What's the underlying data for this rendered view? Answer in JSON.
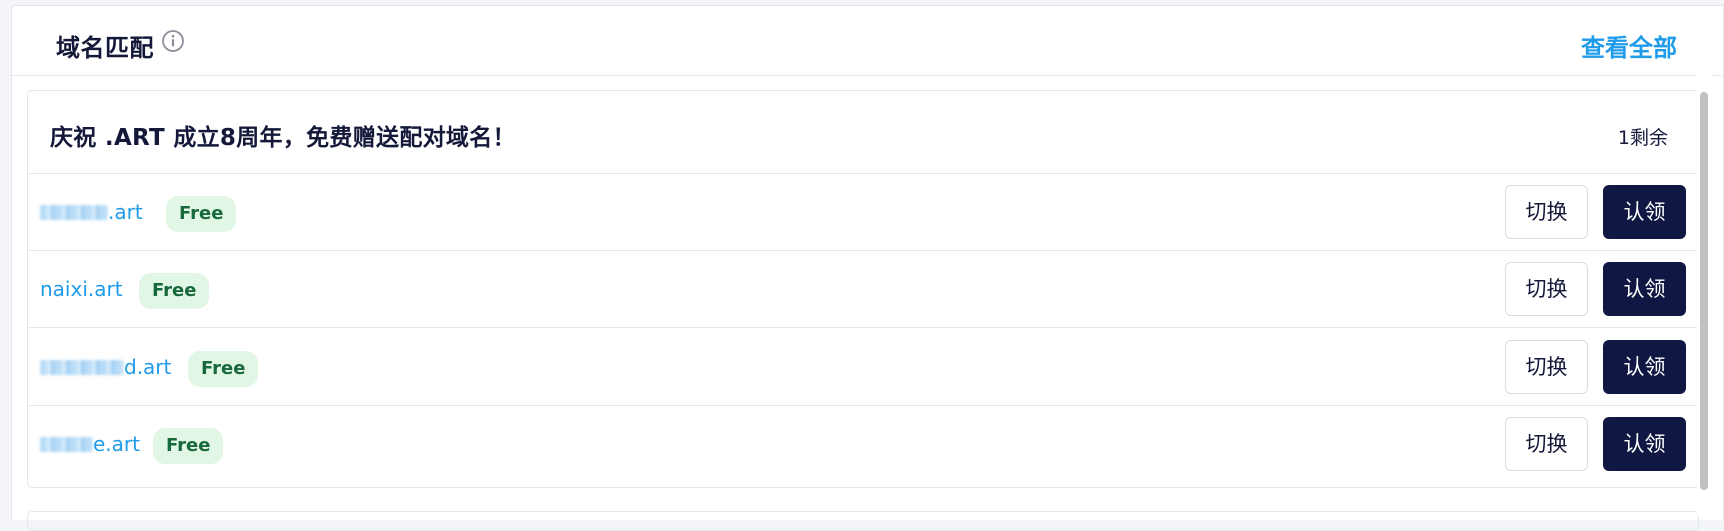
{
  "header": {
    "title": "域名匹配",
    "info_icon": "info-circle-icon",
    "view_all_label": "查看全部"
  },
  "promo": {
    "title": "庆祝 .ART 成立8周年，免费赠送配对域名！",
    "remaining": "1剩余"
  },
  "domains": [
    {
      "suffix": ".art",
      "badge": "Free",
      "switch_label": "切换",
      "claim_label": "认领",
      "masked": true
    },
    {
      "name": "naixi.art",
      "badge": "Free",
      "switch_label": "切换",
      "claim_label": "认领",
      "masked": false
    },
    {
      "suffix": "d.art",
      "badge": "Free",
      "switch_label": "切换",
      "claim_label": "认领",
      "masked": true
    },
    {
      "suffix": "e.art",
      "badge": "Free",
      "switch_label": "切换",
      "claim_label": "认领",
      "masked": true
    }
  ],
  "colors": {
    "accent": "#1f9bea",
    "claim_button": "#0f1742",
    "badge_bg": "#e2f6e6",
    "badge_text": "#17683a"
  }
}
